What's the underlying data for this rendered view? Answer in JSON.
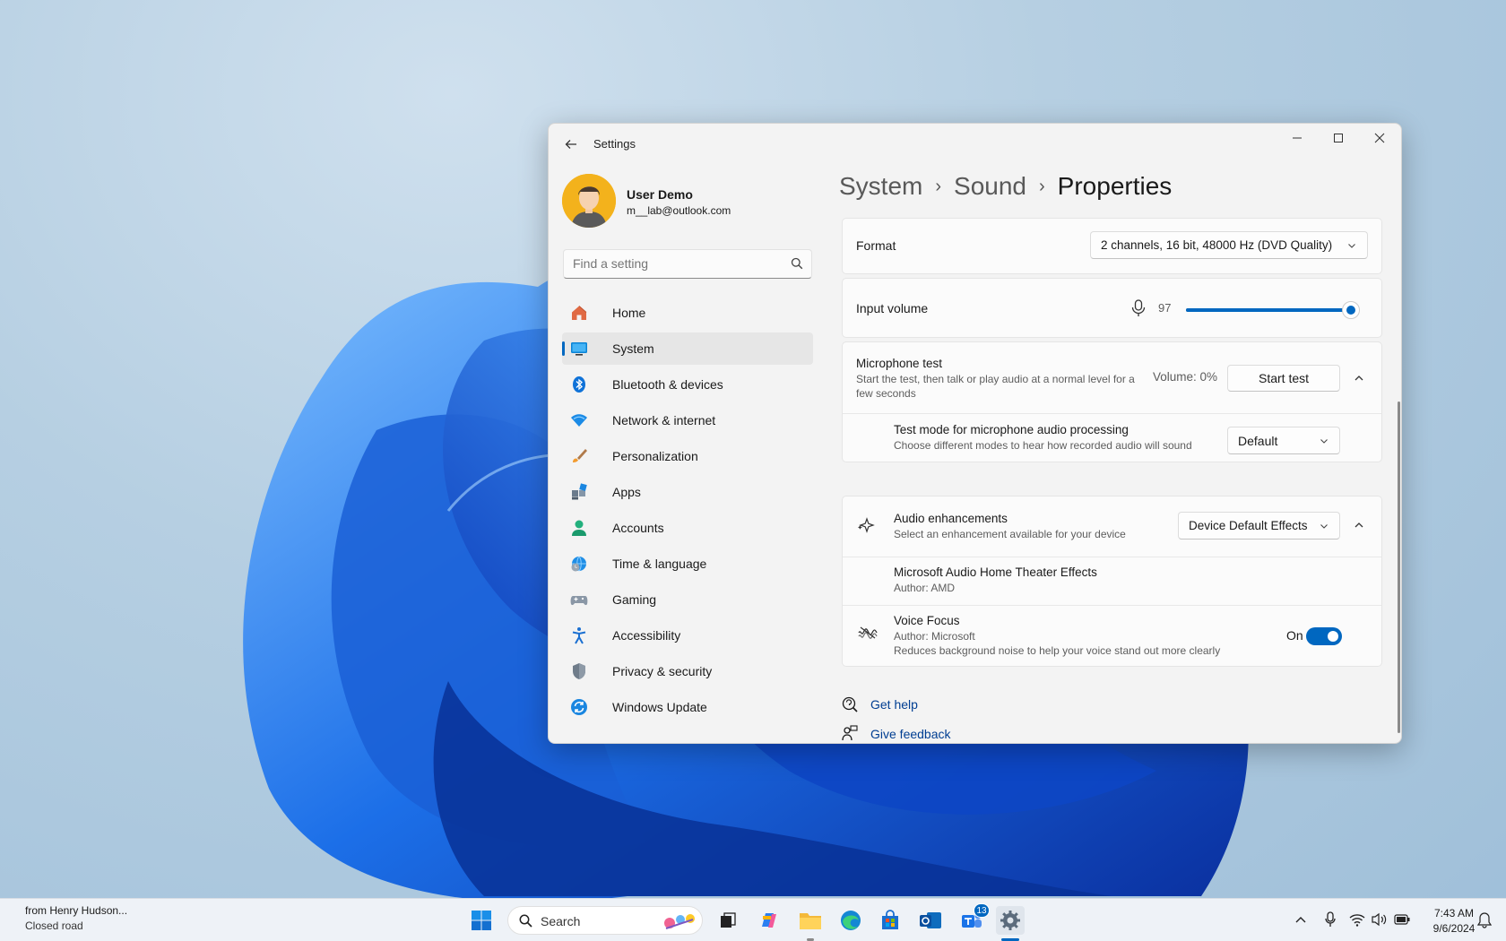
{
  "window": {
    "title": "Settings"
  },
  "user": {
    "name": "User Demo",
    "email": "m__lab@outlook.com"
  },
  "search": {
    "placeholder": "Find a setting"
  },
  "nav": {
    "items": [
      {
        "label": "Home",
        "icon": "home-icon"
      },
      {
        "label": "System",
        "icon": "system-icon",
        "active": true
      },
      {
        "label": "Bluetooth & devices",
        "icon": "bluetooth-icon"
      },
      {
        "label": "Network & internet",
        "icon": "wifi-icon"
      },
      {
        "label": "Personalization",
        "icon": "brush-icon"
      },
      {
        "label": "Apps",
        "icon": "apps-icon"
      },
      {
        "label": "Accounts",
        "icon": "accounts-icon"
      },
      {
        "label": "Time & language",
        "icon": "globe-clock-icon"
      },
      {
        "label": "Gaming",
        "icon": "gamepad-icon"
      },
      {
        "label": "Accessibility",
        "icon": "accessibility-icon"
      },
      {
        "label": "Privacy & security",
        "icon": "shield-icon"
      },
      {
        "label": "Windows Update",
        "icon": "update-icon"
      }
    ]
  },
  "breadcrumb": {
    "first": "System",
    "second": "Sound",
    "current": "Properties",
    "separator": "›"
  },
  "format": {
    "label": "Format",
    "value": "2 channels, 16 bit, 48000 Hz (DVD Quality)"
  },
  "input_volume": {
    "label": "Input volume",
    "value": 97,
    "value_text": "97"
  },
  "mic_test": {
    "title": "Microphone test",
    "description": "Start the test, then talk or play audio at a normal level for a few seconds",
    "volume_text": "Volume: 0%",
    "button": "Start test"
  },
  "test_mode": {
    "title": "Test mode for microphone audio processing",
    "description": "Choose different modes to hear how recorded audio will sound",
    "value": "Default"
  },
  "enhancements": {
    "title": "Audio enhancements",
    "description": "Select an enhancement available for your device",
    "value": "Device Default Effects"
  },
  "effect1": {
    "title": "Microsoft Audio Home Theater Effects",
    "author": "Author: AMD"
  },
  "voice_focus": {
    "title": "Voice Focus",
    "author": "Author: Microsoft",
    "description": "Reduces background noise to help your voice stand out more clearly",
    "state": "On"
  },
  "links": {
    "help": "Get help",
    "feedback": "Give feedback"
  },
  "taskbar": {
    "weather_line1": "from Henry Hudson...",
    "weather_line2": "Closed road",
    "search": "Search",
    "teams_badge": "13",
    "time": "7:43 AM",
    "date": "9/6/2024"
  },
  "colors": {
    "accent": "#0067c0",
    "window_bg": "#f3f3f3",
    "card_bg": "#fbfbfb"
  }
}
